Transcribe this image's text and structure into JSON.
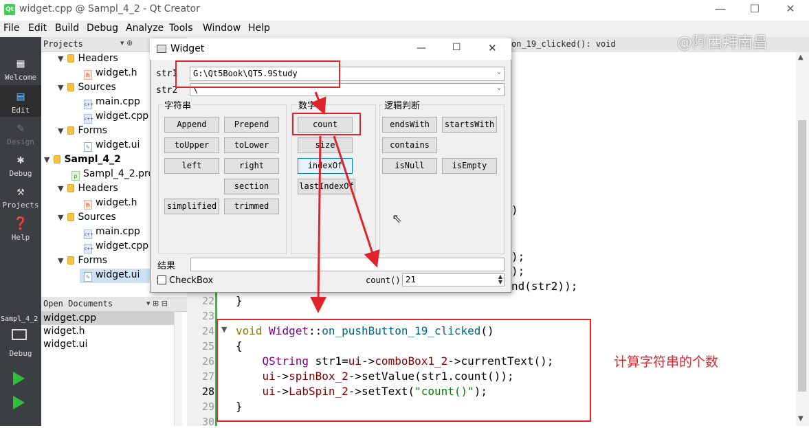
{
  "window": {
    "title": "widget.cpp @ Sampl_4_2 - Qt Creator",
    "icon_text": "Qt"
  },
  "window_controls": {
    "minimize": "—",
    "maximize": "☐",
    "close": "✕"
  },
  "menu": [
    "File",
    "Edit",
    "Build",
    "Debug",
    "Analyze",
    "Tools",
    "Window",
    "Help"
  ],
  "modes": [
    {
      "label": "Welcome",
      "icon": "grid-icon"
    },
    {
      "label": "Edit",
      "icon": "edit-icon"
    },
    {
      "label": "Design",
      "icon": "pencil-icon"
    },
    {
      "label": "Debug",
      "icon": "bug-icon"
    },
    {
      "label": "Projects",
      "icon": "wrench-icon"
    },
    {
      "label": "Help",
      "icon": "help-icon"
    }
  ],
  "left_bottom": {
    "kit_label": "Sampl_4_2",
    "debug_label": "Debug"
  },
  "projects": {
    "title": "Projects",
    "tree": [
      "Headers",
      "widget.h",
      "Sources",
      "main.cpp",
      "widget.cpp",
      "Forms",
      "widget.ui",
      "Sampl_4_2",
      "Sampl_4_2.pro",
      "Headers",
      "widget.h",
      "Sources",
      "main.cpp",
      "widget.cpp",
      "Forms",
      "widget.ui"
    ]
  },
  "open_documents": {
    "title": "Open Documents",
    "items": [
      "widget.cpp",
      "widget.h",
      "widget.ui"
    ]
  },
  "editor": {
    "function_label": "on_19_clicked(): void",
    "partial": [
      ")",
      ");",
      ");",
      "nd(str2));"
    ],
    "lines": [
      {
        "num": "22",
        "text": "}"
      },
      {
        "num": "23",
        "text": ""
      },
      {
        "num": "24",
        "text": "void Widget::on_pushButton_19_clicked()"
      },
      {
        "num": "25",
        "text": "{"
      },
      {
        "num": "26",
        "text": "    QString str1=ui->comboBox1_2->currentText();"
      },
      {
        "num": "27",
        "text": "    ui->spinBox_2->setValue(str1.count());"
      },
      {
        "num": "28",
        "text": "    ui->LabSpin_2->setText(\"count()\");"
      },
      {
        "num": "29",
        "text": "}"
      },
      {
        "num": "30",
        "text": ""
      }
    ]
  },
  "annotation": "计算字符串的个数",
  "watermark": "@阿西拜南昌",
  "dialog": {
    "title": "Widget",
    "str1_label": "str1",
    "str1_value": "G:\\Qt5Book\\QT5.9Study",
    "str2_label": "str2",
    "str2_value": "\\",
    "group_string": "字符串",
    "group_number": "数字",
    "group_logic": "逻辑判断",
    "buttons_string": [
      "Append",
      "Prepend",
      "toUpper",
      "toLower",
      "left",
      "right",
      "section",
      "simplified",
      "trimmed"
    ],
    "buttons_number": [
      "count",
      "size",
      "indexOf",
      "lastIndexOf"
    ],
    "buttons_logic": [
      "endsWith",
      "startsWith",
      "contains",
      "isNull",
      "isEmpty"
    ],
    "result_label": "结果",
    "checkbox_label": "CheckBox",
    "spin_label": "count()",
    "spin_value": "21"
  },
  "colors": {
    "annotation_red": "#e0242c",
    "mode_bar": "#3c3f41",
    "gutter_green": "#2bbf3a"
  }
}
